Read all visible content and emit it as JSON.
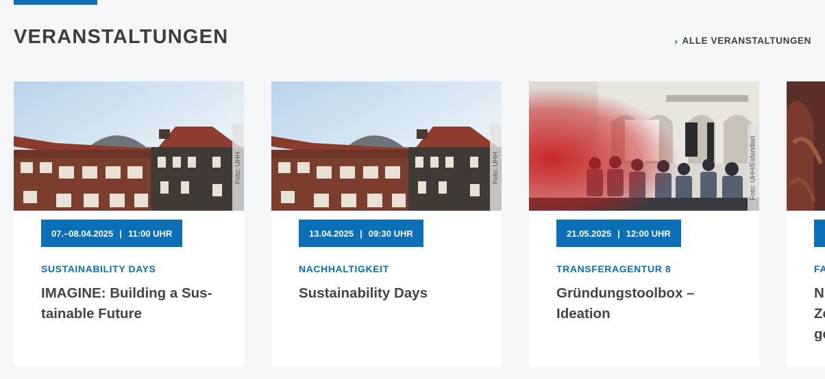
{
  "section": {
    "title": "VERANSTALTUNGEN",
    "all_link_label": "ALLE VERANSTALTUNGEN"
  },
  "events": [
    {
      "date": "07.–08.04.2025",
      "time": "11:00 UHR",
      "category": "SUSTAINABILITY DAYS",
      "title": "IMAGINE: Building a Sus­tainable Future",
      "photo_credit": "Foto: UHH"
    },
    {
      "date": "13.04.2025",
      "time": "09:30 UHR",
      "category": "NACHHALTIGKEIT",
      "title": "Sustainability Days",
      "photo_credit": "Foto: UHH"
    },
    {
      "date": "21.05.2025",
      "time": "12:00 UHR",
      "category": "TRANSFERAGENTUR 8",
      "title": "Gründungstoolbox – Ideation",
      "photo_credit": "Foto: UHH/Esfandiari"
    },
    {
      "date": "",
      "time": "",
      "category": "FA",
      "title": "N Ze ge",
      "photo_credit": ""
    }
  ],
  "colors": {
    "accent": "#0a6fb7",
    "background": "#f5f6f8",
    "card": "#ffffff"
  }
}
